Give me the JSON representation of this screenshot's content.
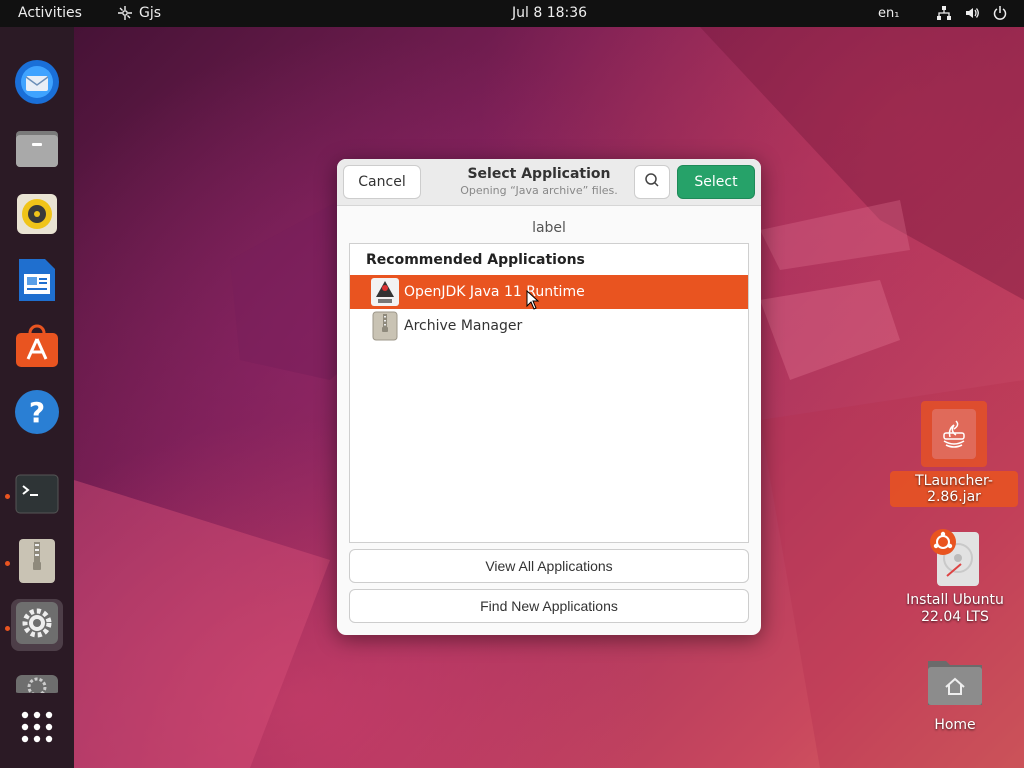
{
  "topbar": {
    "activities": "Activities",
    "app_name": "Gjs",
    "clock": "Jul 8  18:36",
    "language": "en₁",
    "tray_icons": [
      "network-icon",
      "volume-icon",
      "power-icon"
    ]
  },
  "dock": {
    "items": [
      {
        "name": "thunderbird-icon",
        "running": false
      },
      {
        "name": "files-icon",
        "running": false
      },
      {
        "name": "rhythmbox-icon",
        "running": false
      },
      {
        "name": "writer-icon",
        "running": false
      },
      {
        "name": "app-center-icon",
        "running": false
      },
      {
        "name": "help-icon",
        "running": false
      },
      {
        "name": "terminal-icon",
        "running": true
      },
      {
        "name": "archive-manager-icon",
        "running": true
      },
      {
        "name": "settings-icon",
        "running": true
      },
      {
        "name": "updater-icon",
        "running": false
      },
      {
        "name": "show-apps-icon",
        "running": false
      }
    ]
  },
  "desktop": {
    "icons": [
      {
        "label": "TLauncher-2.86.jar",
        "icon": "java-icon",
        "selected": true
      },
      {
        "label": "Install Ubuntu 22.04 LTS",
        "icon": "install-ubuntu-icon",
        "selected": false
      },
      {
        "label": "Home",
        "icon": "home-folder-icon",
        "selected": false
      }
    ]
  },
  "dialog": {
    "cancel_label": "Cancel",
    "title": "Select Application",
    "subtitle": "Opening “Java archive” files.",
    "select_label": "Select",
    "top_label": "label",
    "list_heading": "Recommended Applications",
    "apps": [
      {
        "label": "OpenJDK Java 11 Runtime",
        "icon": "java-icon",
        "selected": true
      },
      {
        "label": "Archive Manager",
        "icon": "archive-icon",
        "selected": false
      }
    ],
    "view_all_label": "View All Applications",
    "find_new_label": "Find New Applications"
  },
  "colors": {
    "accent": "#e95420",
    "select_button": "#26a269",
    "topbar": "#111111",
    "dock": "#2b1a25"
  }
}
